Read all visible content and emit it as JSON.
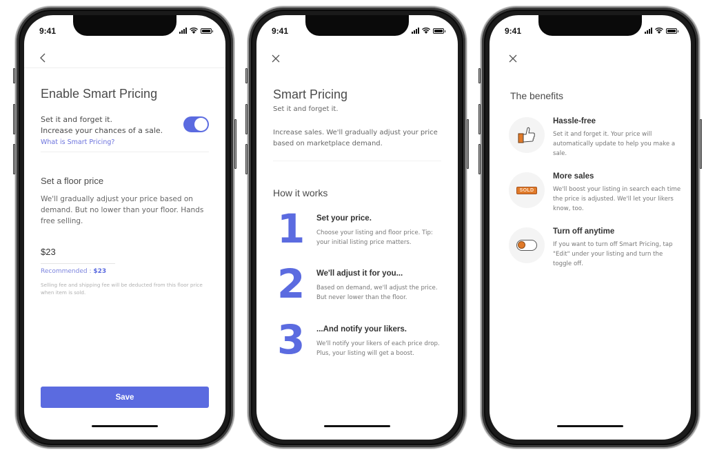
{
  "status_bar": {
    "time": "9:41"
  },
  "screen1": {
    "nav_icon": "back-chevron-icon",
    "title": "Enable Smart Pricing",
    "toggle_text_line1": "Set it and forget it.",
    "toggle_text_line2": "Increase your chances of a sale.",
    "toggle_on": true,
    "link": "What is Smart Pricing?",
    "floor_title": "Set a floor price",
    "floor_desc": "We'll gradually adjust your price based on demand. But no lower than your floor. Hands free selling.",
    "price_value": "$23",
    "recommended_label": "Recommended : ",
    "recommended_value": "$23",
    "fee_note": "Selling fee and shipping fee will be deducted from this floor price when item is sold.",
    "save_label": "Save"
  },
  "screen2": {
    "nav_icon": "close-icon",
    "title": "Smart Pricing",
    "subtitle": "Set it and forget it.",
    "description": "Increase sales. We'll gradually adjust your price based on marketplace demand.",
    "section_title": "How it works",
    "steps": [
      {
        "number": "1",
        "title": "Set your price.",
        "desc": "Choose your listing and floor price. Tip: your initial listing price matters."
      },
      {
        "number": "2",
        "title": "We'll adjust it for you...",
        "desc": "Based on demand, we'll adjust the price. But never lower than the floor."
      },
      {
        "number": "3",
        "title": "...And notify your likers.",
        "desc": "We'll notify your likers of each price drop. Plus, your listing will get a boost."
      }
    ]
  },
  "screen3": {
    "nav_icon": "close-icon",
    "title": "The benefits",
    "benefits": [
      {
        "icon": "thumbs-up-icon",
        "title": "Hassle-free",
        "desc": "Set it and forget it. Your price will automatically update to help you make a sale."
      },
      {
        "icon": "sold-tag-icon",
        "icon_text": "SOLD",
        "title": "More sales",
        "desc": "We'll boost your listing in search each time the price is adjusted. We'll let your likers know, too."
      },
      {
        "icon": "toggle-off-icon",
        "title": "Turn off anytime",
        "desc": "If you want to turn off Smart Pricing, tap \"Edit\" under your listing and turn the toggle off."
      }
    ]
  },
  "colors": {
    "accent": "#5b6be0",
    "link": "#6b72dd",
    "orange": "#e07a2a",
    "text_primary": "#4a4a4a",
    "text_secondary": "#777777"
  }
}
